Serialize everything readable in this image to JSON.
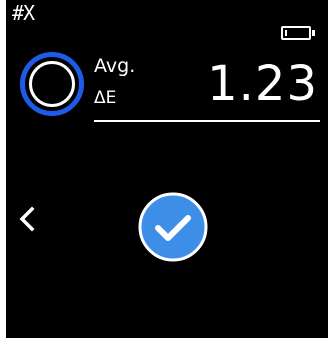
{
  "header": {
    "id_text": "#X",
    "battery": {
      "icon": "battery-icon",
      "level": 0.05
    }
  },
  "measurement": {
    "label_line1": "Avg.",
    "label_line2": "ΔE",
    "value": "1.23",
    "indicator_icon": "ring-indicator-icon"
  },
  "navigation": {
    "back_icon": "chevron-left-icon"
  },
  "status": {
    "icon": "check-circle-icon",
    "color": "#3d8ee6"
  },
  "colors": {
    "background": "#000000",
    "text": "#ffffff",
    "indicator_ring": "#1e5be6",
    "check_fill": "#3d8ee6"
  }
}
